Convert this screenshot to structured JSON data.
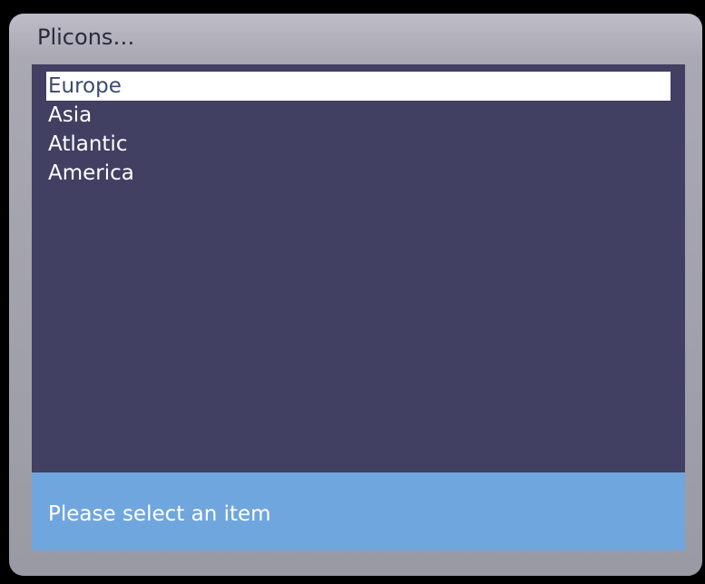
{
  "dialog": {
    "title": "Plicons…"
  },
  "list": {
    "items": [
      {
        "label": "Europe",
        "selected": true
      },
      {
        "label": "Asia",
        "selected": false
      },
      {
        "label": "Atlantic",
        "selected": false
      },
      {
        "label": "America",
        "selected": false
      }
    ]
  },
  "status": {
    "text": "Please select an item"
  },
  "colors": {
    "list_background": "#413f62",
    "selection_background": "#ffffff",
    "status_background": "#6fa6de",
    "frame": "#a9a8b3"
  }
}
